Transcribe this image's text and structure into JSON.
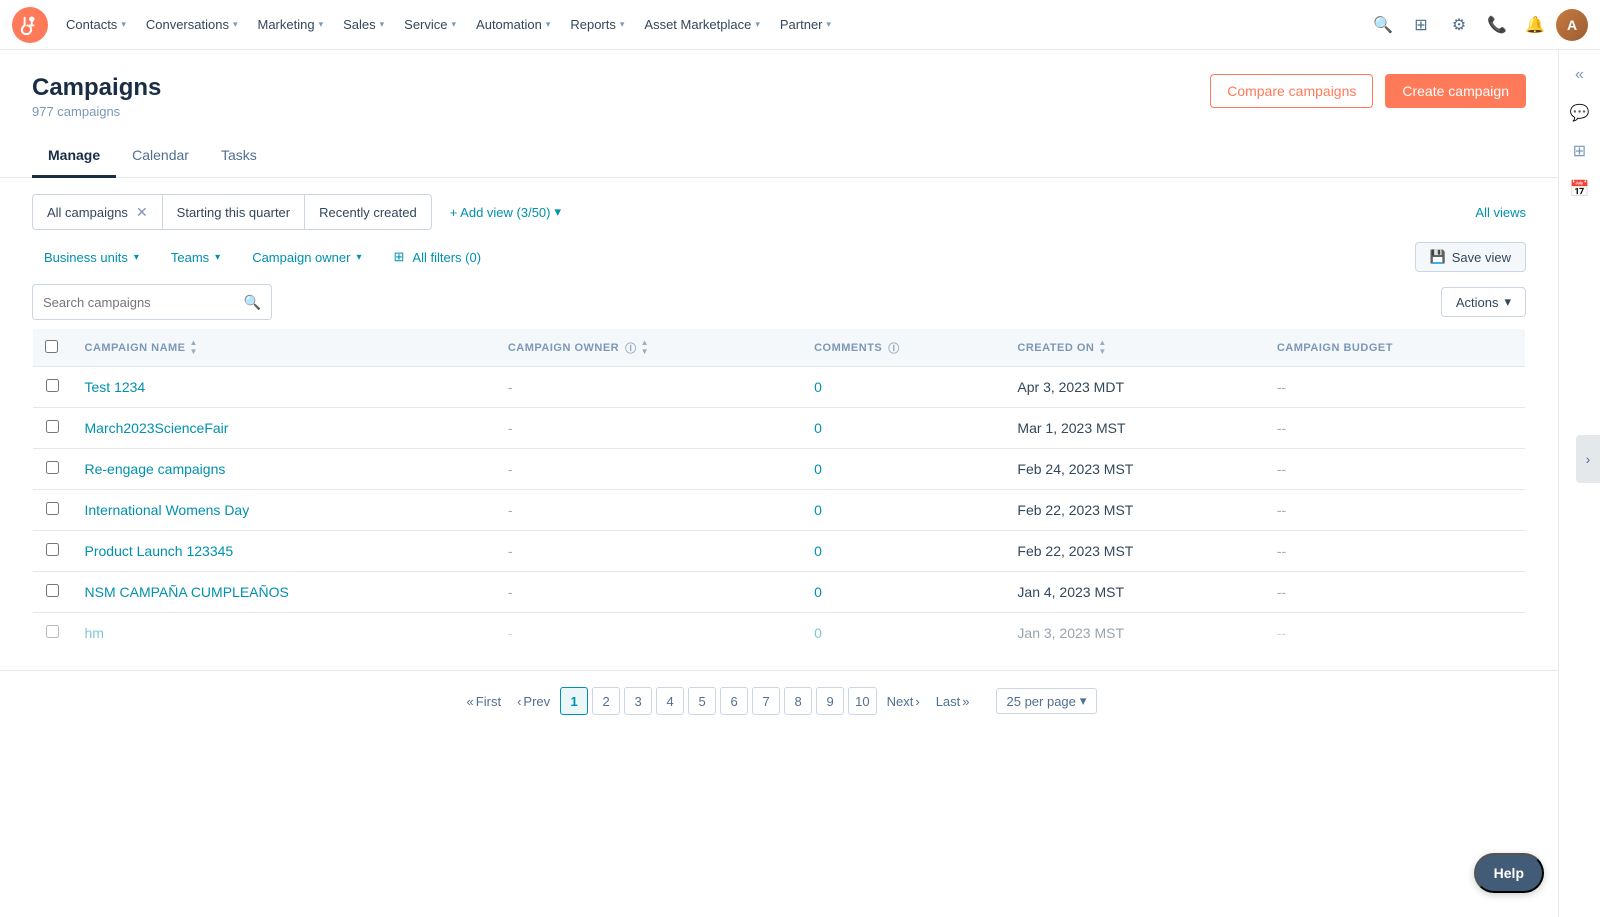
{
  "nav": {
    "items": [
      {
        "label": "Contacts",
        "id": "contacts"
      },
      {
        "label": "Conversations",
        "id": "conversations"
      },
      {
        "label": "Marketing",
        "id": "marketing"
      },
      {
        "label": "Sales",
        "id": "sales"
      },
      {
        "label": "Service",
        "id": "service"
      },
      {
        "label": "Automation",
        "id": "automation"
      },
      {
        "label": "Reports",
        "id": "reports"
      },
      {
        "label": "Asset Marketplace",
        "id": "asset-marketplace"
      },
      {
        "label": "Partner",
        "id": "partner"
      }
    ]
  },
  "page": {
    "title": "Campaigns",
    "subtitle": "977 campaigns",
    "compare_btn": "Compare campaigns",
    "create_btn": "Create campaign"
  },
  "tabs": [
    {
      "label": "Manage",
      "active": true
    },
    {
      "label": "Calendar",
      "active": false
    },
    {
      "label": "Tasks",
      "active": false
    }
  ],
  "filter_pills": [
    {
      "label": "All campaigns",
      "closable": true
    },
    {
      "label": "Starting this quarter",
      "closable": false
    },
    {
      "label": "Recently created",
      "closable": false
    }
  ],
  "add_view": "+ Add view (3/50)",
  "all_views": "All views",
  "filters": {
    "business_units": "Business units",
    "teams": "Teams",
    "campaign_owner": "Campaign owner",
    "all_filters": "All filters (0)",
    "save_view": "Save view"
  },
  "search": {
    "placeholder": "Search campaigns"
  },
  "actions_label": "Actions",
  "table": {
    "columns": [
      {
        "key": "name",
        "label": "Campaign Name",
        "sortable": true
      },
      {
        "key": "owner",
        "label": "Campaign Owner",
        "sortable": true,
        "info": true
      },
      {
        "key": "comments",
        "label": "Comments",
        "sortable": false,
        "info": true
      },
      {
        "key": "created",
        "label": "Created On",
        "sortable": true
      },
      {
        "key": "budget",
        "label": "Campaign Budget",
        "sortable": false
      }
    ],
    "rows": [
      {
        "name": "Test 1234",
        "owner": "-",
        "comments": "0",
        "created": "Apr 3, 2023 MDT",
        "budget": "--"
      },
      {
        "name": "March2023ScienceFair",
        "owner": "-",
        "comments": "0",
        "created": "Mar 1, 2023 MST",
        "budget": "--"
      },
      {
        "name": "Re-engage campaigns",
        "owner": "-",
        "comments": "0",
        "created": "Feb 24, 2023 MST",
        "budget": "--"
      },
      {
        "name": "International Womens Day",
        "owner": "-",
        "comments": "0",
        "created": "Feb 22, 2023 MST",
        "budget": "--"
      },
      {
        "name": "Product Launch 123345",
        "owner": "-",
        "comments": "0",
        "created": "Feb 22, 2023 MST",
        "budget": "--"
      },
      {
        "name": "NSM CAMPAÑA CUMPLEAÑOS",
        "owner": "-",
        "comments": "0",
        "created": "Jan 4, 2023 MST",
        "budget": "--"
      },
      {
        "name": "hm",
        "owner": "-",
        "comments": "0",
        "created": "Jan 3, 2023 MST",
        "budget": "--"
      }
    ]
  },
  "pagination": {
    "first": "First",
    "prev": "Prev",
    "next": "Next",
    "last": "Last",
    "pages": [
      "1",
      "2",
      "3",
      "4",
      "5",
      "6",
      "7",
      "8",
      "9",
      "10"
    ],
    "active_page": "1",
    "per_page": "25 per page"
  },
  "help_label": "Help",
  "right_panel": {
    "icons": [
      "chat-icon",
      "grid-icon",
      "calendar-icon"
    ]
  },
  "colors": {
    "accent": "#0091ae",
    "orange": "#ff7a59",
    "link": "#0091ae"
  }
}
